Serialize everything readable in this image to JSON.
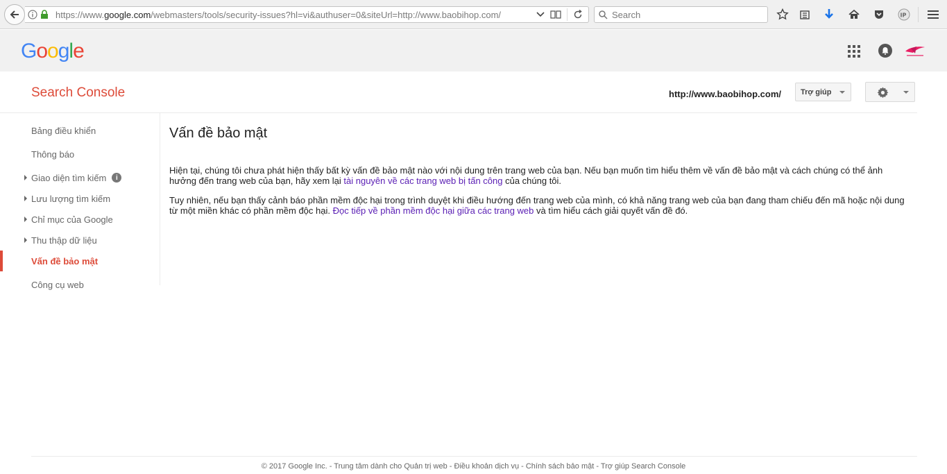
{
  "browser": {
    "url_prefix": "https://www.",
    "url_host": "google.com",
    "url_path": "/webmasters/tools/security-issues?hl=vi&authuser=0&siteUrl=http://www.baobihop.com/",
    "search_placeholder": "Search"
  },
  "header": {
    "logo": [
      "G",
      "o",
      "o",
      "g",
      "l",
      "e"
    ],
    "logo_colors": [
      "#4285f4",
      "#ea4335",
      "#fbbc05",
      "#4285f4",
      "#34a853",
      "#ea4335"
    ]
  },
  "console": {
    "title": "Search Console",
    "site_url": "http://www.baobihop.com/",
    "help_label": "Trợ giúp"
  },
  "sidebar": {
    "items": [
      {
        "label": "Bảng điều khiển",
        "expandable": false,
        "active": false
      },
      {
        "label": "Thông báo",
        "expandable": false,
        "active": false
      },
      {
        "label": "Giao diện tìm kiếm",
        "expandable": true,
        "active": false,
        "info": true
      },
      {
        "label": "Lưu lượng tìm kiếm",
        "expandable": true,
        "active": false
      },
      {
        "label": "Chỉ mục của Google",
        "expandable": true,
        "active": false
      },
      {
        "label": "Thu thập dữ liệu",
        "expandable": true,
        "active": false
      },
      {
        "label": "Vấn đề bảo mật",
        "expandable": false,
        "active": true
      },
      {
        "label": "Công cụ web",
        "expandable": false,
        "active": false
      }
    ]
  },
  "main": {
    "title": "Vấn đề bảo mật",
    "p1_before": "Hiện tại, chúng tôi chưa phát hiện thấy bất kỳ vấn đề bảo mật nào với nội dung trên trang web của bạn. Nếu bạn muốn tìm hiểu thêm về vấn đề bảo mật và cách chúng có thể ảnh hưởng đến trang web của bạn, hãy xem lại ",
    "p1_link": "tài nguyên về các trang web bị tấn công",
    "p1_after": " của chúng tôi.",
    "p2_before": "Tuy nhiên, nếu bạn thấy cảnh báo phần mềm độc hại trong trình duyệt khi điều hướng đến trang web của mình, có khả năng trang web của bạn đang tham chiếu đến mã hoặc nội dung từ một miền khác có phần mềm độc hại. ",
    "p2_link": "Đọc tiếp về phần mềm độc hại giữa các trang web",
    "p2_after": " và tìm hiểu cách giải quyết vấn đề đó."
  },
  "footer": {
    "copyright": "© 2017 Google Inc.",
    "sep": " - ",
    "links": [
      "Trung tâm dành cho Quản trị web",
      "Điều khoản dịch vụ",
      "Chính sách bảo mật",
      "Trợ giúp Search Console"
    ]
  }
}
